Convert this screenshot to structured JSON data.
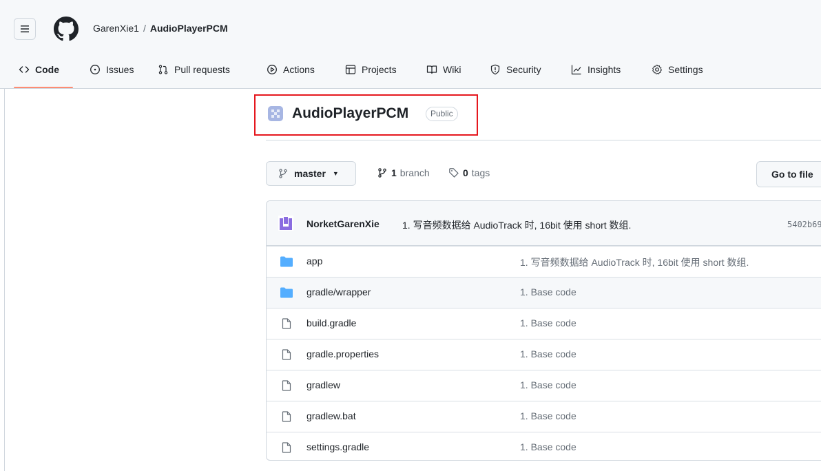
{
  "header": {
    "owner": "GarenXie1",
    "separator": "/",
    "repo": "AudioPlayerPCM"
  },
  "nav": {
    "code": "Code",
    "issues": "Issues",
    "pulls": "Pull requests",
    "actions": "Actions",
    "projects": "Projects",
    "wiki": "Wiki",
    "security": "Security",
    "insights": "Insights",
    "settings": "Settings"
  },
  "repo": {
    "title": "AudioPlayerPCM",
    "visibility": "Public"
  },
  "branch": {
    "current": "master",
    "branch_count": "1",
    "branch_label": "branch",
    "tag_count": "0",
    "tag_label": "tags",
    "goto_file": "Go to file"
  },
  "commit": {
    "author": "NorketGarenXie",
    "message": "1. 写音频数据给 AudioTrack 时, 16bit 使用 short 数组.",
    "sha": "5402b69"
  },
  "files": [
    {
      "name": "app",
      "type": "folder",
      "message": "1. 写音频数据给 AudioTrack 时, 16bit 使用 short 数组."
    },
    {
      "name": "gradle/wrapper",
      "type": "folder",
      "message": "1. Base code"
    },
    {
      "name": "build.gradle",
      "type": "file",
      "message": "1. Base code"
    },
    {
      "name": "gradle.properties",
      "type": "file",
      "message": "1. Base code"
    },
    {
      "name": "gradlew",
      "type": "file",
      "message": "1. Base code"
    },
    {
      "name": "gradlew.bat",
      "type": "file",
      "message": "1. Base code"
    },
    {
      "name": "settings.gradle",
      "type": "file",
      "message": "1. Base code"
    }
  ],
  "colors": {
    "accent_underline": "#fd8c73",
    "highlight_box": "#e5171e",
    "folder": "#54aeff"
  }
}
